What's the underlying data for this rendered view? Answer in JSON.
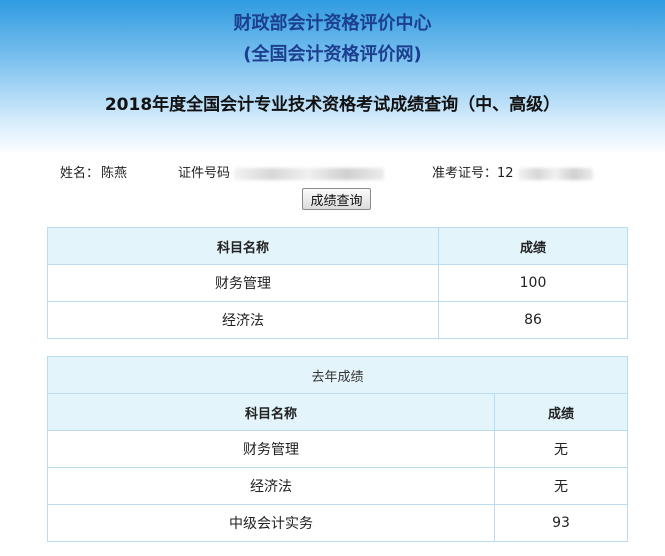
{
  "header": {
    "org_line1": "财政部会计资格评价中心",
    "org_line2": "(全国会计资格评价网)",
    "title": "2018年度全国会计专业技术资格考试成绩查询（中、高级）"
  },
  "candidate": {
    "name_label": "姓名：",
    "name_value": "陈燕",
    "id_label": "证件号码",
    "exam_label": "准考证号：",
    "exam_prefix": "12"
  },
  "query_button": "成绩查询",
  "current_scores": {
    "columns": [
      "科目名称",
      "成绩"
    ],
    "rows": [
      {
        "subject": "财务管理",
        "score": "100"
      },
      {
        "subject": "经济法",
        "score": "86"
      }
    ]
  },
  "last_year": {
    "caption": "去年成绩",
    "columns": [
      "科目名称",
      "成绩"
    ],
    "rows": [
      {
        "subject": "财务管理",
        "score": "无"
      },
      {
        "subject": "经济法",
        "score": "无"
      },
      {
        "subject": "中级会计实务",
        "score": "93"
      }
    ]
  }
}
